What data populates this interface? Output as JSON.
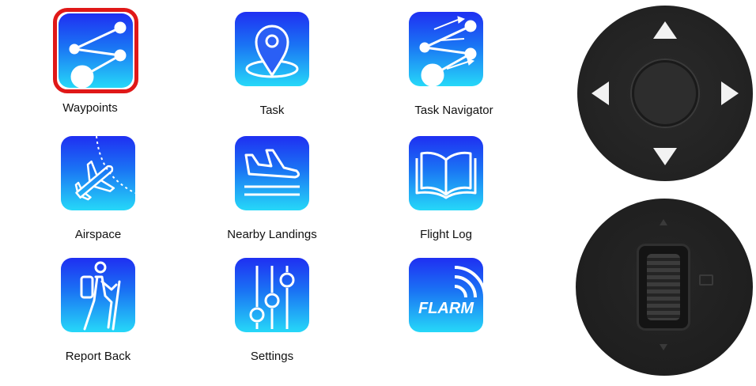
{
  "menu": {
    "items": [
      {
        "label": "Waypoints",
        "icon": "waypoints-icon",
        "selected": true
      },
      {
        "label": "Task",
        "icon": "task-pin-icon",
        "selected": false
      },
      {
        "label": "Task Navigator",
        "icon": "task-navigator-icon",
        "selected": false
      },
      {
        "label": "Airspace",
        "icon": "airspace-plane-icon",
        "selected": false
      },
      {
        "label": "Nearby Landings",
        "icon": "landing-plane-icon",
        "selected": false
      },
      {
        "label": "Flight Log",
        "icon": "open-book-icon",
        "selected": false
      },
      {
        "label": "Report Back",
        "icon": "hiker-icon",
        "selected": false
      },
      {
        "label": "Settings",
        "icon": "sliders-icon",
        "selected": false
      },
      {
        "label": "",
        "icon": "flarm-icon",
        "selected": false,
        "logo_text": "FLARM"
      }
    ]
  },
  "colors": {
    "selection_ring": "#e01818",
    "icon_gradient_top": "#1f2ff2",
    "icon_gradient_bottom": "#26d8f8",
    "knob": "#222222"
  },
  "controls": {
    "dpad_icons": [
      "arrow-up-icon",
      "arrow-left-icon",
      "arrow-right-icon",
      "arrow-down-icon"
    ],
    "scroll_wheel_icon": "scroll-wheel-icon"
  }
}
